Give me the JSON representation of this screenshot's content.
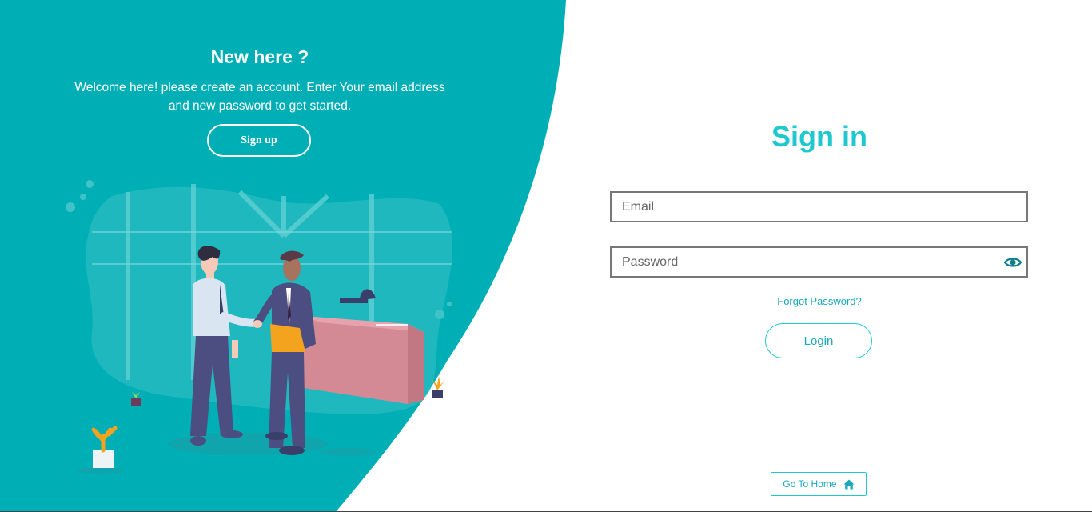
{
  "colors": {
    "teal_panel": "#00aeb5",
    "accent": "#1fc7cf",
    "link": "#1aa8b8"
  },
  "left_panel": {
    "title": "New here ?",
    "description": "Welcome here! please create an account. Enter Your email address and new password to get started.",
    "signup_label": "Sign up",
    "illustration": "two-men-handshake-office-illustration"
  },
  "signin": {
    "title": "Sign in",
    "email_placeholder": "Email",
    "email_value": "",
    "password_placeholder": "Password",
    "password_value": "",
    "password_toggle_icon": "eye-icon",
    "forgot_label": "Forgot Password?",
    "login_label": "Login",
    "home_label": "Go To Home",
    "home_icon": "home-icon"
  }
}
